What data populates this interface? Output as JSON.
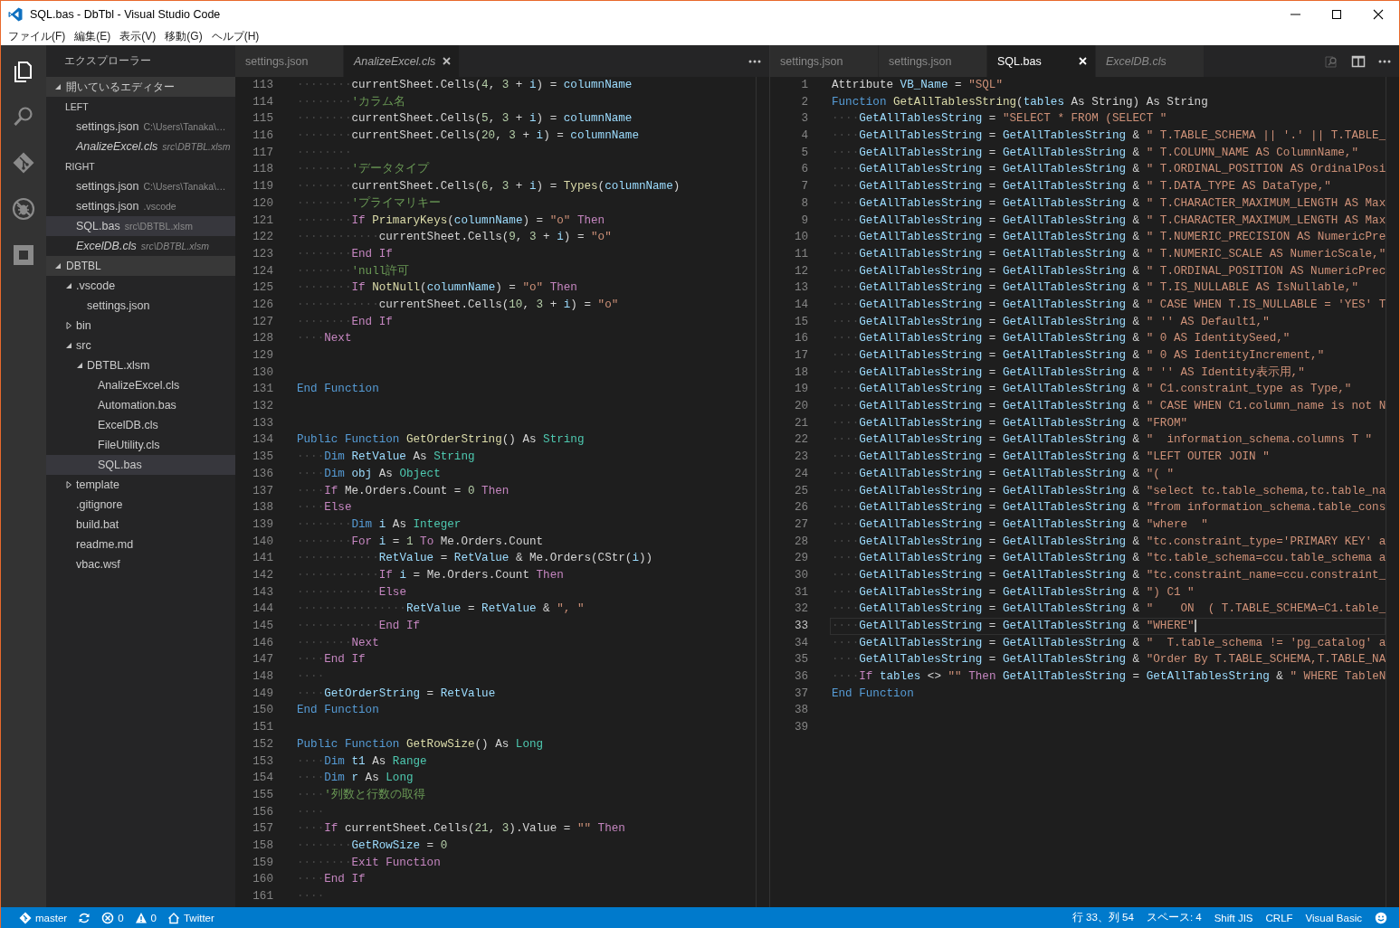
{
  "window": {
    "title": "SQL.bas - DbTbl - Visual Studio Code"
  },
  "menu": [
    "ファイル(F)",
    "編集(E)",
    "表示(V)",
    "移動(G)",
    "ヘルプ(H)"
  ],
  "activity_bar": [
    {
      "kind": "explorer",
      "selected": true
    },
    {
      "kind": "search",
      "selected": false
    },
    {
      "kind": "git",
      "selected": false
    },
    {
      "kind": "debug",
      "selected": false
    },
    {
      "kind": "extensions",
      "selected": false
    }
  ],
  "sidebar": {
    "title": "エクスプローラー",
    "open_editors": {
      "title": "開いているエディター",
      "expanded": true,
      "groups": [
        {
          "name": "LEFT",
          "items": [
            {
              "name": "settings.json",
              "path": "C:\\Users\\Tanaka\\…",
              "preview": false,
              "selected": false
            },
            {
              "name": "AnalizeExcel.cls",
              "path": "src\\DBTBL.xlsm",
              "preview": true,
              "selected": false
            }
          ]
        },
        {
          "name": "RIGHT",
          "items": [
            {
              "name": "settings.json",
              "path": "C:\\Users\\Tanaka\\…",
              "preview": false,
              "selected": false
            },
            {
              "name": "settings.json",
              "path": ".vscode",
              "preview": false,
              "selected": false
            },
            {
              "name": "SQL.bas",
              "path": "src\\DBTBL.xlsm",
              "preview": false,
              "selected": true
            },
            {
              "name": "ExcelDB.cls",
              "path": "src\\DBTBL.xlsm",
              "preview": true,
              "selected": false
            }
          ]
        }
      ]
    },
    "folder": {
      "title": "DBTBL",
      "expanded": true,
      "items": [
        {
          "name": ".vscode",
          "kind": "folder",
          "expanded": true,
          "selected": false,
          "children": [
            {
              "name": "settings.json",
              "kind": "file",
              "selected": false
            }
          ]
        },
        {
          "name": "bin",
          "kind": "folder",
          "expanded": false,
          "selected": false
        },
        {
          "name": "src",
          "kind": "folder",
          "expanded": true,
          "selected": false,
          "children": [
            {
              "name": "DBTBL.xlsm",
              "kind": "folder",
              "expanded": true,
              "selected": false,
              "children": [
                {
                  "name": "AnalizeExcel.cls",
                  "kind": "file",
                  "selected": false
                },
                {
                  "name": "Automation.bas",
                  "kind": "file",
                  "selected": false
                },
                {
                  "name": "ExcelDB.cls",
                  "kind": "file",
                  "selected": false
                },
                {
                  "name": "FileUtility.cls",
                  "kind": "file",
                  "selected": false
                },
                {
                  "name": "SQL.bas",
                  "kind": "file",
                  "selected": true
                }
              ]
            }
          ]
        },
        {
          "name": "template",
          "kind": "folder",
          "expanded": false,
          "selected": false
        },
        {
          "name": ".gitignore",
          "kind": "file",
          "selected": false
        },
        {
          "name": "build.bat",
          "kind": "file",
          "selected": false
        },
        {
          "name": "readme.md",
          "kind": "file",
          "selected": false
        },
        {
          "name": "vbac.wsf",
          "kind": "file",
          "selected": false
        }
      ]
    }
  },
  "editors": [
    {
      "focused": false,
      "tabs": [
        {
          "label": "settings.json",
          "preview": false,
          "selected": false
        },
        {
          "label": "AnalizeExcel.cls",
          "preview": true,
          "selected": true
        }
      ],
      "actions": [
        {
          "kind": "more"
        }
      ],
      "lines": [
        {
          "n": "113",
          "tokens": [
            {
              "ws": "········"
            },
            {
              "plain": "currentSheet.Cells("
            },
            {
              "num": "4"
            },
            {
              "plain": ", "
            },
            {
              "num": "3"
            },
            {
              "plain": " + "
            },
            {
              "var": "i"
            },
            {
              "plain": ") = "
            },
            {
              "var": "columnName"
            }
          ]
        },
        {
          "n": "114",
          "tokens": [
            {
              "ws": "········"
            },
            {
              "com": "'カラム名"
            }
          ]
        },
        {
          "n": "115",
          "tokens": [
            {
              "ws": "········"
            },
            {
              "plain": "currentSheet.Cells("
            },
            {
              "num": "5"
            },
            {
              "plain": ", "
            },
            {
              "num": "3"
            },
            {
              "plain": " + "
            },
            {
              "var": "i"
            },
            {
              "plain": ") = "
            },
            {
              "var": "columnName"
            }
          ]
        },
        {
          "n": "116",
          "tokens": [
            {
              "ws": "········"
            },
            {
              "plain": "currentSheet.Cells("
            },
            {
              "num": "20"
            },
            {
              "plain": ", "
            },
            {
              "num": "3"
            },
            {
              "plain": " + "
            },
            {
              "var": "i"
            },
            {
              "plain": ") = "
            },
            {
              "var": "columnName"
            }
          ]
        },
        {
          "n": "117",
          "tokens": [
            {
              "ws": "········"
            }
          ]
        },
        {
          "n": "118",
          "tokens": [
            {
              "ws": "········"
            },
            {
              "com": "'データタイプ"
            }
          ]
        },
        {
          "n": "119",
          "tokens": [
            {
              "ws": "········"
            },
            {
              "plain": "currentSheet.Cells("
            },
            {
              "num": "6"
            },
            {
              "plain": ", "
            },
            {
              "num": "3"
            },
            {
              "plain": " + "
            },
            {
              "var": "i"
            },
            {
              "plain": ") = "
            },
            {
              "fn": "Types"
            },
            {
              "plain": "("
            },
            {
              "var": "columnName"
            },
            {
              "plain": ")"
            }
          ]
        },
        {
          "n": "120",
          "tokens": [
            {
              "ws": "········"
            },
            {
              "com": "'プライマリキー"
            }
          ]
        },
        {
          "n": "121",
          "tokens": [
            {
              "ws": "········"
            },
            {
              "kw": "If "
            },
            {
              "fn": "PrimaryKeys"
            },
            {
              "plain": "("
            },
            {
              "var": "columnName"
            },
            {
              "plain": ") = "
            },
            {
              "str": "\"o\" "
            },
            {
              "kw": "Then"
            }
          ]
        },
        {
          "n": "122",
          "tokens": [
            {
              "ws": "············"
            },
            {
              "plain": "currentSheet.Cells("
            },
            {
              "num": "9"
            },
            {
              "plain": ", "
            },
            {
              "num": "3"
            },
            {
              "plain": " + "
            },
            {
              "var": "i"
            },
            {
              "plain": ") = "
            },
            {
              "str": "\"o\""
            }
          ]
        },
        {
          "n": "123",
          "tokens": [
            {
              "ws": "········"
            },
            {
              "kw": "End If"
            }
          ]
        },
        {
          "n": "124",
          "tokens": [
            {
              "ws": "········"
            },
            {
              "com": "'null許可"
            }
          ]
        },
        {
          "n": "125",
          "tokens": [
            {
              "ws": "········"
            },
            {
              "kw": "If "
            },
            {
              "fn": "NotNull"
            },
            {
              "plain": "("
            },
            {
              "var": "columnName"
            },
            {
              "plain": ") = "
            },
            {
              "str": "\"o\" "
            },
            {
              "kw": "Then"
            }
          ]
        },
        {
          "n": "126",
          "tokens": [
            {
              "ws": "············"
            },
            {
              "plain": "currentSheet.Cells("
            },
            {
              "num": "10"
            },
            {
              "plain": ", "
            },
            {
              "num": "3"
            },
            {
              "plain": " + "
            },
            {
              "var": "i"
            },
            {
              "plain": ") = "
            },
            {
              "str": "\"o\""
            }
          ]
        },
        {
          "n": "127",
          "tokens": [
            {
              "ws": "········"
            },
            {
              "kw": "End If"
            }
          ]
        },
        {
          "n": "128",
          "tokens": [
            {
              "ws": "····"
            },
            {
              "kw": "Next"
            }
          ]
        },
        {
          "n": "129"
        },
        {
          "n": "130"
        },
        {
          "n": "131",
          "tokens": [
            {
              "decl": "End Function"
            }
          ]
        },
        {
          "n": "132"
        },
        {
          "n": "133"
        },
        {
          "n": "134",
          "tokens": [
            {
              "decl": "Public Function "
            },
            {
              "fn": "GetOrderString"
            },
            {
              "plain": "() As "
            },
            {
              "type": "String"
            }
          ]
        },
        {
          "n": "135",
          "tokens": [
            {
              "ws": "····"
            },
            {
              "decl": "Dim "
            },
            {
              "var": "RetValue"
            },
            {
              "plain": " As "
            },
            {
              "type": "String"
            }
          ]
        },
        {
          "n": "136",
          "tokens": [
            {
              "ws": "····"
            },
            {
              "decl": "Dim "
            },
            {
              "var": "obj"
            },
            {
              "plain": " As "
            },
            {
              "type": "Object"
            }
          ]
        },
        {
          "n": "137",
          "tokens": [
            {
              "ws": "····"
            },
            {
              "kw": "If"
            },
            {
              "plain": " Me.Orders.Count = "
            },
            {
              "num": "0 "
            },
            {
              "kw": "Then"
            }
          ]
        },
        {
          "n": "138",
          "tokens": [
            {
              "ws": "····"
            },
            {
              "kw": "Else"
            }
          ]
        },
        {
          "n": "139",
          "tokens": [
            {
              "ws": "········"
            },
            {
              "decl": "Dim "
            },
            {
              "var": "i"
            },
            {
              "plain": " As "
            },
            {
              "type": "Integer"
            }
          ]
        },
        {
          "n": "140",
          "tokens": [
            {
              "ws": "········"
            },
            {
              "kw": "For "
            },
            {
              "var": "i"
            },
            {
              "plain": " = "
            },
            {
              "num": "1 "
            },
            {
              "kw": "To"
            },
            {
              "plain": " Me.Orders.Count"
            }
          ]
        },
        {
          "n": "141",
          "tokens": [
            {
              "ws": "············"
            },
            {
              "var": "RetValue"
            },
            {
              "plain": " = "
            },
            {
              "var": "RetValue"
            },
            {
              "plain": " & Me.Orders(CStr("
            },
            {
              "var": "i"
            },
            {
              "plain": "))"
            }
          ]
        },
        {
          "n": "142",
          "tokens": [
            {
              "ws": "············"
            },
            {
              "kw": "If "
            },
            {
              "var": "i"
            },
            {
              "plain": " = Me.Orders.Count "
            },
            {
              "kw": "Then"
            }
          ]
        },
        {
          "n": "143",
          "tokens": [
            {
              "ws": "············"
            },
            {
              "kw": "Else"
            }
          ]
        },
        {
          "n": "144",
          "tokens": [
            {
              "ws": "················"
            },
            {
              "var": "RetValue"
            },
            {
              "plain": " = "
            },
            {
              "var": "RetValue"
            },
            {
              "plain": " & "
            },
            {
              "str": "\", \""
            }
          ]
        },
        {
          "n": "145",
          "tokens": [
            {
              "ws": "············"
            },
            {
              "kw": "End If"
            }
          ]
        },
        {
          "n": "146",
          "tokens": [
            {
              "ws": "········"
            },
            {
              "kw": "Next"
            }
          ]
        },
        {
          "n": "147",
          "tokens": [
            {
              "ws": "····"
            },
            {
              "kw": "End If"
            }
          ]
        },
        {
          "n": "148",
          "tokens": [
            {
              "ws": "····"
            }
          ]
        },
        {
          "n": "149",
          "tokens": [
            {
              "ws": "····"
            },
            {
              "var": "GetOrderString"
            },
            {
              "plain": " = "
            },
            {
              "var": "RetValue"
            }
          ]
        },
        {
          "n": "150",
          "tokens": [
            {
              "decl": "End Function"
            }
          ]
        },
        {
          "n": "151"
        },
        {
          "n": "152",
          "tokens": [
            {
              "decl": "Public Function "
            },
            {
              "fn": "GetRowSize"
            },
            {
              "plain": "() As "
            },
            {
              "type": "Long"
            }
          ]
        },
        {
          "n": "153",
          "tokens": [
            {
              "ws": "····"
            },
            {
              "decl": "Dim "
            },
            {
              "var": "t1"
            },
            {
              "plain": " As "
            },
            {
              "type": "Range"
            }
          ]
        },
        {
          "n": "154",
          "tokens": [
            {
              "ws": "····"
            },
            {
              "decl": "Dim "
            },
            {
              "var": "r"
            },
            {
              "plain": " As "
            },
            {
              "type": "Long"
            }
          ]
        },
        {
          "n": "155",
          "tokens": [
            {
              "ws": "····"
            },
            {
              "com": "'列数と行数の取得"
            }
          ]
        },
        {
          "n": "156",
          "tokens": [
            {
              "ws": "····"
            }
          ]
        },
        {
          "n": "157",
          "tokens": [
            {
              "ws": "····"
            },
            {
              "kw": "If"
            },
            {
              "plain": " currentSheet.Cells("
            },
            {
              "num": "21"
            },
            {
              "plain": ", "
            },
            {
              "num": "3"
            },
            {
              "plain": ").Value = "
            },
            {
              "str": "\"\" "
            },
            {
              "kw": "Then"
            }
          ]
        },
        {
          "n": "158",
          "tokens": [
            {
              "ws": "········"
            },
            {
              "var": "GetRowSize"
            },
            {
              "plain": " = "
            },
            {
              "num": "0"
            }
          ]
        },
        {
          "n": "159",
          "tokens": [
            {
              "ws": "········"
            },
            {
              "kw": "Exit Function"
            }
          ]
        },
        {
          "n": "160",
          "tokens": [
            {
              "ws": "····"
            },
            {
              "kw": "End If"
            }
          ]
        },
        {
          "n": "161",
          "tokens": [
            {
              "ws": "····"
            }
          ]
        }
      ]
    },
    {
      "focused": true,
      "tabs": [
        {
          "label": "settings.json",
          "preview": false,
          "selected": false
        },
        {
          "label": "settings.json",
          "preview": false,
          "selected": false
        },
        {
          "label": "SQL.bas",
          "preview": false,
          "selected": true
        },
        {
          "label": "ExcelDB.cls",
          "preview": true,
          "selected": false
        }
      ],
      "actions": [
        {
          "kind": "preview"
        },
        {
          "kind": "split"
        },
        {
          "kind": "more"
        }
      ],
      "lines": [
        {
          "n": "1",
          "current": false,
          "tokens": [
            {
              "plain": "Attribute "
            },
            {
              "var": "VB_Name"
            },
            {
              "plain": " = "
            },
            {
              "str": "\"SQL\""
            }
          ]
        },
        {
          "n": "2",
          "current": false,
          "tokens": [
            {
              "decl": "Function "
            },
            {
              "fn": "GetAllTablesString"
            },
            {
              "plain": "("
            },
            {
              "var": "tables"
            },
            {
              "plain": " As String) As String"
            }
          ]
        },
        {
          "n": "3",
          "current": false,
          "tokens": [
            {
              "ws": "····"
            },
            {
              "var": "GetAllTablesString"
            },
            {
              "plain": " = "
            },
            {
              "str": "\"SELECT * FROM (SELECT \""
            }
          ]
        },
        {
          "n": "4",
          "current": false,
          "tokens": [
            {
              "ws": "····"
            },
            {
              "var": "GetAllTablesString"
            },
            {
              "plain": " = "
            },
            {
              "var": "GetAllTablesString"
            },
            {
              "plain": " & "
            },
            {
              "str": "\" T.TABLE_SCHEMA || '.' || T.TABLE_"
            }
          ]
        },
        {
          "n": "5",
          "current": false,
          "tokens": [
            {
              "ws": "····"
            },
            {
              "var": "GetAllTablesString"
            },
            {
              "plain": " = "
            },
            {
              "var": "GetAllTablesString"
            },
            {
              "plain": " & "
            },
            {
              "str": "\" T.COLUMN_NAME AS ColumnName,\""
            }
          ]
        },
        {
          "n": "6",
          "current": false,
          "tokens": [
            {
              "ws": "····"
            },
            {
              "var": "GetAllTablesString"
            },
            {
              "plain": " = "
            },
            {
              "var": "GetAllTablesString"
            },
            {
              "plain": " & "
            },
            {
              "str": "\" T.ORDINAL_POSITION AS OrdinalPosi"
            }
          ]
        },
        {
          "n": "7",
          "current": false,
          "tokens": [
            {
              "ws": "····"
            },
            {
              "var": "GetAllTablesString"
            },
            {
              "plain": " = "
            },
            {
              "var": "GetAllTablesString"
            },
            {
              "plain": " & "
            },
            {
              "str": "\" T.DATA_TYPE AS DataType,\""
            }
          ]
        },
        {
          "n": "8",
          "current": false,
          "tokens": [
            {
              "ws": "····"
            },
            {
              "var": "GetAllTablesString"
            },
            {
              "plain": " = "
            },
            {
              "var": "GetAllTablesString"
            },
            {
              "plain": " & "
            },
            {
              "str": "\" T.CHARACTER_MAXIMUM_LENGTH AS Max"
            }
          ]
        },
        {
          "n": "9",
          "current": false,
          "tokens": [
            {
              "ws": "····"
            },
            {
              "var": "GetAllTablesString"
            },
            {
              "plain": " = "
            },
            {
              "var": "GetAllTablesString"
            },
            {
              "plain": " & "
            },
            {
              "str": "\" T.CHARACTER_MAXIMUM_LENGTH AS Max"
            }
          ]
        },
        {
          "n": "10",
          "current": false,
          "tokens": [
            {
              "ws": "····"
            },
            {
              "var": "GetAllTablesString"
            },
            {
              "plain": " = "
            },
            {
              "var": "GetAllTablesString"
            },
            {
              "plain": " & "
            },
            {
              "str": "\" T.NUMERIC_PRECISION AS NumericPre"
            }
          ]
        },
        {
          "n": "11",
          "current": false,
          "tokens": [
            {
              "ws": "····"
            },
            {
              "var": "GetAllTablesString"
            },
            {
              "plain": " = "
            },
            {
              "var": "GetAllTablesString"
            },
            {
              "plain": " & "
            },
            {
              "str": "\" T.NUMERIC_SCALE AS NumericScale,\""
            }
          ]
        },
        {
          "n": "12",
          "current": false,
          "tokens": [
            {
              "ws": "····"
            },
            {
              "var": "GetAllTablesString"
            },
            {
              "plain": " = "
            },
            {
              "var": "GetAllTablesString"
            },
            {
              "plain": " & "
            },
            {
              "str": "\" T.ORDINAL_POSITION AS NumericPrec"
            }
          ]
        },
        {
          "n": "13",
          "current": false,
          "tokens": [
            {
              "ws": "····"
            },
            {
              "var": "GetAllTablesString"
            },
            {
              "plain": " = "
            },
            {
              "var": "GetAllTablesString"
            },
            {
              "plain": " & "
            },
            {
              "str": "\" T.IS_NULLABLE AS IsNullable,\""
            }
          ]
        },
        {
          "n": "14",
          "current": false,
          "tokens": [
            {
              "ws": "····"
            },
            {
              "var": "GetAllTablesString"
            },
            {
              "plain": " = "
            },
            {
              "var": "GetAllTablesString"
            },
            {
              "plain": " & "
            },
            {
              "str": "\" CASE WHEN T.IS_NULLABLE = 'YES' T"
            }
          ]
        },
        {
          "n": "15",
          "current": false,
          "tokens": [
            {
              "ws": "····"
            },
            {
              "var": "GetAllTablesString"
            },
            {
              "plain": " = "
            },
            {
              "var": "GetAllTablesString"
            },
            {
              "plain": " & "
            },
            {
              "str": "\" '' AS Default1,\""
            }
          ]
        },
        {
          "n": "16",
          "current": false,
          "tokens": [
            {
              "ws": "····"
            },
            {
              "var": "GetAllTablesString"
            },
            {
              "plain": " = "
            },
            {
              "var": "GetAllTablesString"
            },
            {
              "plain": " & "
            },
            {
              "str": "\" 0 AS IdentitySeed,\""
            }
          ]
        },
        {
          "n": "17",
          "current": false,
          "tokens": [
            {
              "ws": "····"
            },
            {
              "var": "GetAllTablesString"
            },
            {
              "plain": " = "
            },
            {
              "var": "GetAllTablesString"
            },
            {
              "plain": " & "
            },
            {
              "str": "\" 0 AS IdentityIncrement,\""
            }
          ]
        },
        {
          "n": "18",
          "current": false,
          "tokens": [
            {
              "ws": "····"
            },
            {
              "var": "GetAllTablesString"
            },
            {
              "plain": " = "
            },
            {
              "var": "GetAllTablesString"
            },
            {
              "plain": " & "
            },
            {
              "str": "\" '' AS Identity表示用,\""
            }
          ]
        },
        {
          "n": "19",
          "current": false,
          "tokens": [
            {
              "ws": "····"
            },
            {
              "var": "GetAllTablesString"
            },
            {
              "plain": " = "
            },
            {
              "var": "GetAllTablesString"
            },
            {
              "plain": " & "
            },
            {
              "str": "\" C1.constraint_type as Type,\""
            }
          ]
        },
        {
          "n": "20",
          "current": false,
          "tokens": [
            {
              "ws": "····"
            },
            {
              "var": "GetAllTablesString"
            },
            {
              "plain": " = "
            },
            {
              "var": "GetAllTablesString"
            },
            {
              "plain": " & "
            },
            {
              "str": "\" CASE WHEN C1.column_name is not N"
            }
          ]
        },
        {
          "n": "21",
          "current": false,
          "tokens": [
            {
              "ws": "····"
            },
            {
              "var": "GetAllTablesString"
            },
            {
              "plain": " = "
            },
            {
              "var": "GetAllTablesString"
            },
            {
              "plain": " & "
            },
            {
              "str": "\"FROM\""
            }
          ]
        },
        {
          "n": "22",
          "current": false,
          "tokens": [
            {
              "ws": "····"
            },
            {
              "var": "GetAllTablesString"
            },
            {
              "plain": " = "
            },
            {
              "var": "GetAllTablesString"
            },
            {
              "plain": " & "
            },
            {
              "str": "\"  information_schema.columns T \""
            }
          ]
        },
        {
          "n": "23",
          "current": false,
          "tokens": [
            {
              "ws": "····"
            },
            {
              "var": "GetAllTablesString"
            },
            {
              "plain": " = "
            },
            {
              "var": "GetAllTablesString"
            },
            {
              "plain": " & "
            },
            {
              "str": "\"LEFT OUTER JOIN \""
            }
          ]
        },
        {
          "n": "24",
          "current": false,
          "tokens": [
            {
              "ws": "····"
            },
            {
              "var": "GetAllTablesString"
            },
            {
              "plain": " = "
            },
            {
              "var": "GetAllTablesString"
            },
            {
              "plain": " & "
            },
            {
              "str": "\"( \""
            }
          ]
        },
        {
          "n": "25",
          "current": false,
          "tokens": [
            {
              "ws": "····"
            },
            {
              "var": "GetAllTablesString"
            },
            {
              "plain": " = "
            },
            {
              "var": "GetAllTablesString"
            },
            {
              "plain": " & "
            },
            {
              "str": "\"select tc.table_schema,tc.table_na"
            }
          ]
        },
        {
          "n": "26",
          "current": false,
          "tokens": [
            {
              "ws": "····"
            },
            {
              "var": "GetAllTablesString"
            },
            {
              "plain": " = "
            },
            {
              "var": "GetAllTablesString"
            },
            {
              "plain": " & "
            },
            {
              "str": "\"from information_schema.table_cons"
            }
          ]
        },
        {
          "n": "27",
          "current": false,
          "tokens": [
            {
              "ws": "····"
            },
            {
              "var": "GetAllTablesString"
            },
            {
              "plain": " = "
            },
            {
              "var": "GetAllTablesString"
            },
            {
              "plain": " & "
            },
            {
              "str": "\"where  \""
            }
          ]
        },
        {
          "n": "28",
          "current": false,
          "tokens": [
            {
              "ws": "····"
            },
            {
              "var": "GetAllTablesString"
            },
            {
              "plain": " = "
            },
            {
              "var": "GetAllTablesString"
            },
            {
              "plain": " & "
            },
            {
              "str": "\"tc.constraint_type='PRIMARY KEY' a"
            }
          ]
        },
        {
          "n": "29",
          "current": false,
          "tokens": [
            {
              "ws": "····"
            },
            {
              "var": "GetAllTablesString"
            },
            {
              "plain": " = "
            },
            {
              "var": "GetAllTablesString"
            },
            {
              "plain": " & "
            },
            {
              "str": "\"tc.table_schema=ccu.table_schema a"
            }
          ]
        },
        {
          "n": "30",
          "current": false,
          "tokens": [
            {
              "ws": "····"
            },
            {
              "var": "GetAllTablesString"
            },
            {
              "plain": " = "
            },
            {
              "var": "GetAllTablesString"
            },
            {
              "plain": " & "
            },
            {
              "str": "\"tc.constraint_name=ccu.constraint_"
            }
          ]
        },
        {
          "n": "31",
          "current": false,
          "tokens": [
            {
              "ws": "····"
            },
            {
              "var": "GetAllTablesString"
            },
            {
              "plain": " = "
            },
            {
              "var": "GetAllTablesString"
            },
            {
              "plain": " & "
            },
            {
              "str": "\") C1 \""
            }
          ]
        },
        {
          "n": "32",
          "current": false,
          "tokens": [
            {
              "ws": "····"
            },
            {
              "var": "GetAllTablesString"
            },
            {
              "plain": " = "
            },
            {
              "var": "GetAllTablesString"
            },
            {
              "plain": " & "
            },
            {
              "str": "\"    ON  ( T.TABLE_SCHEMA=C1.table_"
            }
          ]
        },
        {
          "n": "33",
          "current": true,
          "tokens": [
            {
              "ws": "····"
            },
            {
              "var": "GetAllTablesString"
            },
            {
              "plain": " = "
            },
            {
              "var": "GetAllTablesString"
            },
            {
              "plain": " & "
            },
            {
              "str": "\"WHERE\""
            }
          ]
        },
        {
          "n": "34",
          "current": false,
          "tokens": [
            {
              "ws": "····"
            },
            {
              "var": "GetAllTablesString"
            },
            {
              "plain": " = "
            },
            {
              "var": "GetAllTablesString"
            },
            {
              "plain": " & "
            },
            {
              "str": "\"  T.table_schema != 'pg_catalog' a"
            }
          ]
        },
        {
          "n": "35",
          "current": false,
          "tokens": [
            {
              "ws": "····"
            },
            {
              "var": "GetAllTablesString"
            },
            {
              "plain": " = "
            },
            {
              "var": "GetAllTablesString"
            },
            {
              "plain": " & "
            },
            {
              "str": "\"Order By T.TABLE_SCHEMA,T.TABLE_NA"
            }
          ]
        },
        {
          "n": "36",
          "current": false,
          "tokens": [
            {
              "ws": "····"
            },
            {
              "kw": "If "
            },
            {
              "var": "tables"
            },
            {
              "plain": " <> "
            },
            {
              "str": "\"\" "
            },
            {
              "kw": "Then "
            },
            {
              "var": "GetAllTablesString"
            },
            {
              "plain": " = "
            },
            {
              "var": "GetAllTablesString"
            },
            {
              "plain": " & "
            },
            {
              "str": "\" WHERE TableN"
            }
          ]
        },
        {
          "n": "37",
          "current": false,
          "tokens": [
            {
              "decl": "End Function"
            }
          ]
        },
        {
          "n": "38",
          "current": false
        },
        {
          "n": "39",
          "current": false
        }
      ]
    }
  ],
  "status_bar": {
    "left": [
      {
        "kind": "branch",
        "text": "master"
      },
      {
        "kind": "sync"
      },
      {
        "kind": "errors",
        "text": "0"
      },
      {
        "kind": "warnings",
        "text": "0"
      },
      {
        "kind": "home",
        "text": "Twitter"
      }
    ],
    "right": [
      {
        "kind": "text",
        "text": "行 33、列 54"
      },
      {
        "kind": "text",
        "text": "スペース: 4"
      },
      {
        "kind": "text",
        "text": "Shift JIS"
      },
      {
        "kind": "text",
        "text": "CRLF"
      },
      {
        "kind": "text",
        "text": "Visual Basic"
      },
      {
        "kind": "feedback"
      }
    ]
  }
}
